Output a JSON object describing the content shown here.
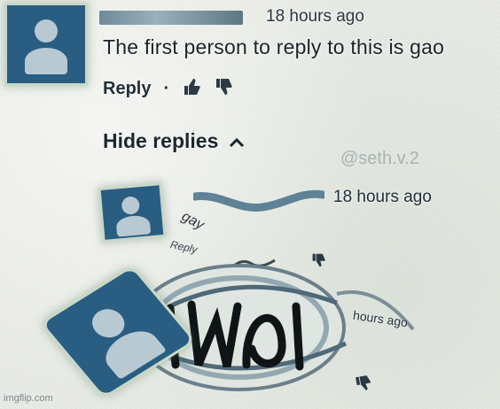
{
  "comment": {
    "timestamp": "18 hours ago",
    "text": "The first person to reply to this is gao",
    "reply_label": "Reply",
    "separator": "·"
  },
  "replies_toggle": {
    "label": "Hide replies",
    "icon": "chevron-up-icon"
  },
  "watermark": "@seth.v.2",
  "reply": {
    "timestamp": "18 hours ago",
    "text": "gay",
    "reply_label": "Reply"
  },
  "zoomed": {
    "timestamp": "hours ago"
  },
  "footer": {
    "credit": "imgflip.com"
  },
  "colors": {
    "background": "#e9ece6",
    "avatar": "#2a5d82",
    "text": "#1f2a33"
  }
}
